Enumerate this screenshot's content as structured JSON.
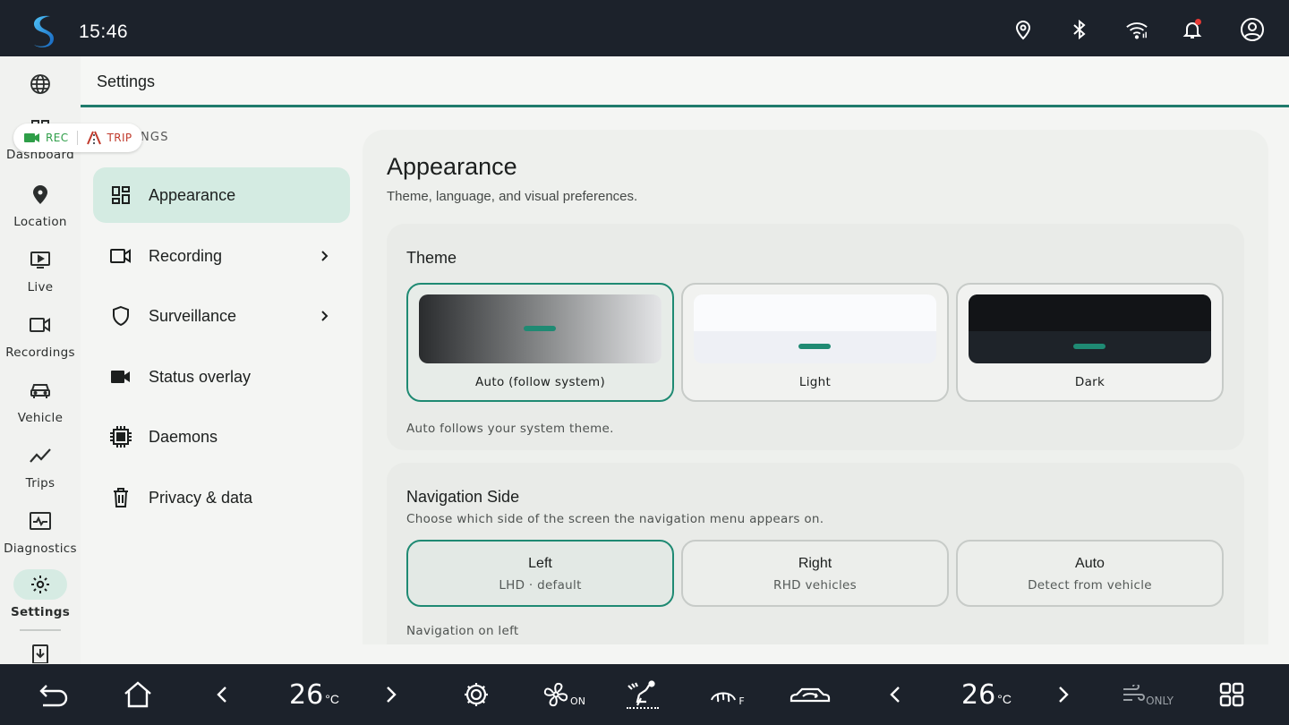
{
  "status_bar": {
    "time": "15:46",
    "icons": [
      "location-pin-icon",
      "bluetooth-icon",
      "wifi-icon",
      "bell-icon",
      "account-icon"
    ],
    "notification_dot_color": "#e53935"
  },
  "rail": {
    "items": [
      {
        "label": "",
        "icon": "globe-icon"
      },
      {
        "label": "Dashboard",
        "icon": "dashboard-icon"
      },
      {
        "label": "Location",
        "icon": "map-pin-icon"
      },
      {
        "label": "Live",
        "icon": "live-play-icon"
      },
      {
        "label": "Recordings",
        "icon": "video-camera-icon"
      },
      {
        "label": "Vehicle",
        "icon": "car-icon"
      },
      {
        "label": "Trips",
        "icon": "trend-line-icon"
      },
      {
        "label": "Diagnostics",
        "icon": "diagnostics-icon"
      },
      {
        "label": "Settings",
        "icon": "gear-icon"
      }
    ],
    "active": "Settings"
  },
  "header": {
    "title": "Settings"
  },
  "rec_pill": {
    "rec": "REC",
    "trip": "TRIP",
    "rec_color": "#2e9e48",
    "trip_color": "#c0392b"
  },
  "menu": {
    "caption": "NGS",
    "items": [
      {
        "label": "Appearance",
        "icon": "grid-icon",
        "chevron": false
      },
      {
        "label": "Recording",
        "icon": "video-camera-icon",
        "chevron": true
      },
      {
        "label": "Surveillance",
        "icon": "shield-icon",
        "chevron": true
      },
      {
        "label": "Status overlay",
        "icon": "video-filled-icon",
        "chevron": false
      },
      {
        "label": "Daemons",
        "icon": "chip-icon",
        "chevron": false
      },
      {
        "label": "Privacy & data",
        "icon": "trash-icon",
        "chevron": false
      }
    ],
    "active": "Appearance"
  },
  "appearance": {
    "title": "Appearance",
    "subtitle": "Theme, language, and visual preferences.",
    "theme": {
      "title": "Theme",
      "options": [
        "Auto (follow system)",
        "Light",
        "Dark"
      ],
      "selected": "Auto (follow system)",
      "note": "Auto follows your system theme."
    },
    "navigation_side": {
      "title": "Navigation Side",
      "description": "Choose which side of the screen the navigation menu appears on.",
      "options": [
        {
          "title": "Left",
          "subtitle": "LHD · default"
        },
        {
          "title": "Right",
          "subtitle": "RHD vehicles"
        },
        {
          "title": "Auto",
          "subtitle": "Detect from vehicle"
        }
      ],
      "selected": "Left",
      "note": "Navigation on left"
    }
  },
  "bottom_bar": {
    "left_temp": "26",
    "right_temp": "26",
    "temp_unit": "°C",
    "fan_tag": "ON",
    "rear_defrost_tag": "F",
    "only_tag": "ONLY"
  },
  "colors": {
    "accent": "#1f8a73",
    "bar_bg": "#1c222b",
    "selected_menu_bg": "#d4ebe2"
  }
}
